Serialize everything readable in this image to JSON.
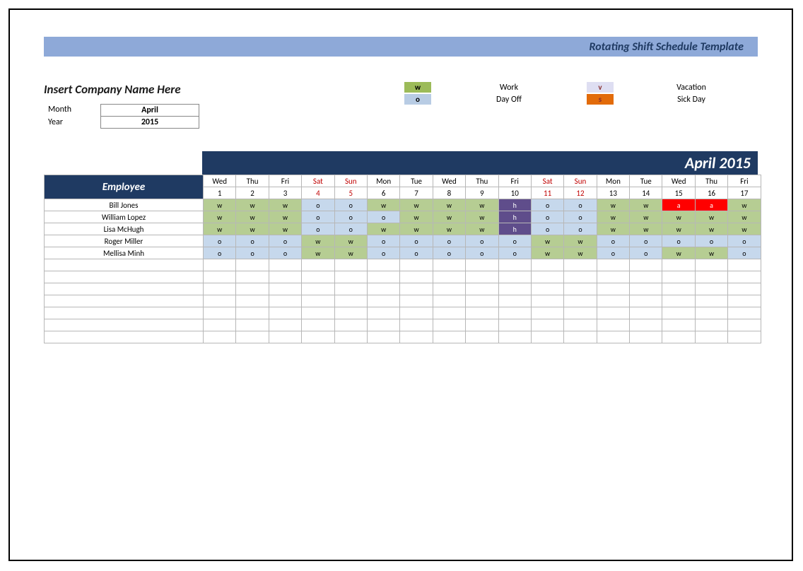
{
  "title": "Rotating Shift Schedule Template",
  "company_placeholder": "Insert Company Name Here",
  "meta": {
    "month_label": "Month",
    "month_value": "April",
    "year_label": "Year",
    "year_value": "2015"
  },
  "legend": {
    "w_code": "w",
    "w_label": "Work",
    "o_code": "o",
    "o_label": "Day Off",
    "v_code": "v",
    "v_label": "Vacation",
    "s_code": "s",
    "s_label": "Sick Day"
  },
  "month_banner": "April 2015",
  "header": {
    "employee": "Employee",
    "days": [
      {
        "dow": "Wed",
        "num": "1",
        "weekend": false
      },
      {
        "dow": "Thu",
        "num": "2",
        "weekend": false
      },
      {
        "dow": "Fri",
        "num": "3",
        "weekend": false
      },
      {
        "dow": "Sat",
        "num": "4",
        "weekend": true
      },
      {
        "dow": "Sun",
        "num": "5",
        "weekend": true
      },
      {
        "dow": "Mon",
        "num": "6",
        "weekend": false
      },
      {
        "dow": "Tue",
        "num": "7",
        "weekend": false
      },
      {
        "dow": "Wed",
        "num": "8",
        "weekend": false
      },
      {
        "dow": "Thu",
        "num": "9",
        "weekend": false
      },
      {
        "dow": "Fri",
        "num": "10",
        "weekend": false
      },
      {
        "dow": "Sat",
        "num": "11",
        "weekend": true
      },
      {
        "dow": "Sun",
        "num": "12",
        "weekend": true
      },
      {
        "dow": "Mon",
        "num": "13",
        "weekend": false
      },
      {
        "dow": "Tue",
        "num": "14",
        "weekend": false
      },
      {
        "dow": "Wed",
        "num": "15",
        "weekend": false
      },
      {
        "dow": "Thu",
        "num": "16",
        "weekend": false
      },
      {
        "dow": "Fri",
        "num": "17",
        "weekend": false
      }
    ]
  },
  "employees": [
    {
      "name": "Bill Jones",
      "shifts": [
        "w",
        "w",
        "w",
        "o",
        "o",
        "w",
        "w",
        "w",
        "w",
        "h",
        "o",
        "o",
        "w",
        "w",
        "a",
        "a",
        "w"
      ]
    },
    {
      "name": "William Lopez",
      "shifts": [
        "w",
        "w",
        "w",
        "o",
        "o",
        "o",
        "w",
        "w",
        "w",
        "h",
        "o",
        "o",
        "w",
        "w",
        "w",
        "w",
        "w"
      ]
    },
    {
      "name": "Lisa McHugh",
      "shifts": [
        "w",
        "w",
        "w",
        "o",
        "o",
        "w",
        "w",
        "w",
        "w",
        "h",
        "o",
        "o",
        "w",
        "w",
        "w",
        "w",
        "w"
      ]
    },
    {
      "name": "Roger Miller",
      "shifts": [
        "o",
        "o",
        "o",
        "w",
        "w",
        "o",
        "o",
        "o",
        "o",
        "o",
        "w",
        "w",
        "o",
        "o",
        "o",
        "o",
        "o"
      ]
    },
    {
      "name": "Mellisa Minh",
      "shifts": [
        "o",
        "o",
        "o",
        "w",
        "w",
        "o",
        "o",
        "o",
        "o",
        "o",
        "w",
        "w",
        "o",
        "o",
        "w",
        "w",
        "o"
      ]
    }
  ],
  "blank_rows": 7,
  "codes": {
    "w": "w",
    "o": "o",
    "h": "h",
    "a": "a"
  }
}
